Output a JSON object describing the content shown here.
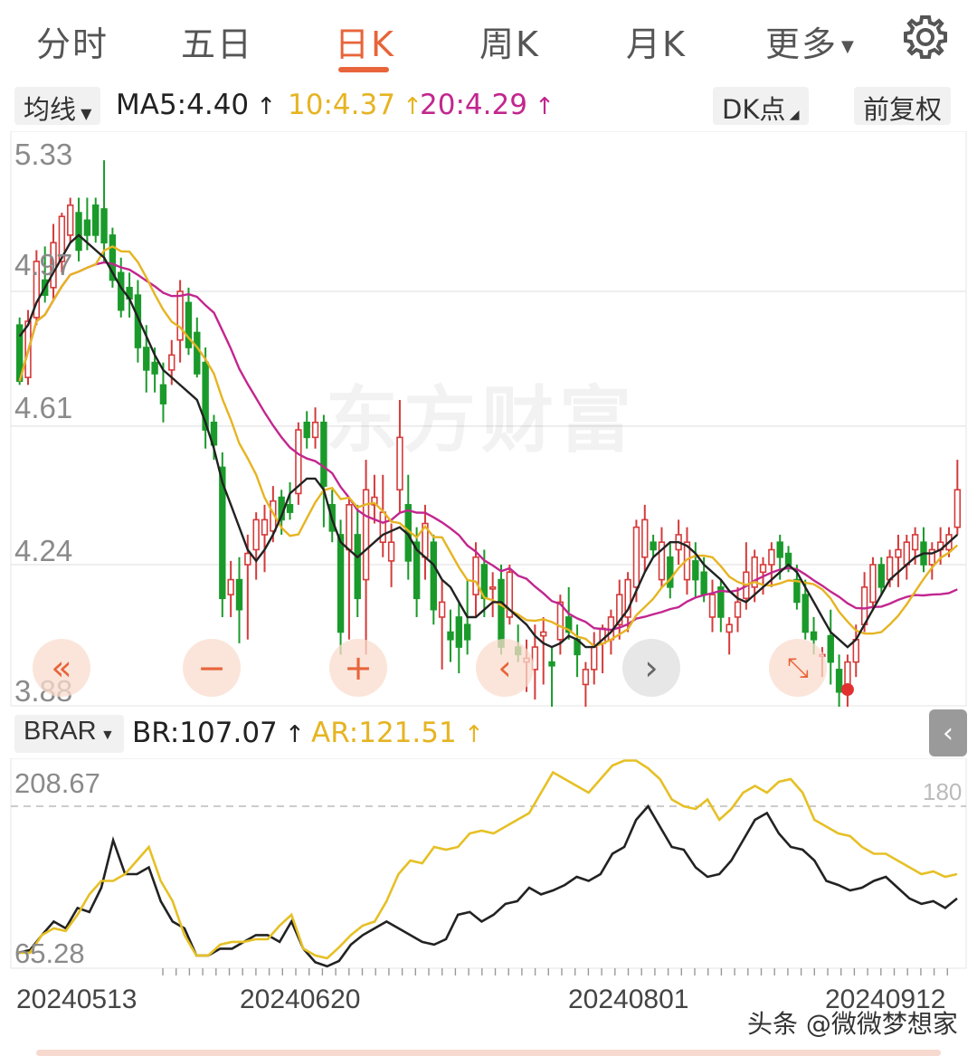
{
  "tabs": [
    {
      "label": "分时"
    },
    {
      "label": "五日"
    },
    {
      "label": "日K"
    },
    {
      "label": "周K"
    },
    {
      "label": "月K"
    },
    {
      "label": "更多"
    }
  ],
  "active_tab": "日K",
  "indicator_bar": {
    "ma_selector": "均线",
    "ma5": "MA5:4.40",
    "ma10": "10:4.37",
    "ma20": "20:4.29",
    "dk_button": "DK点",
    "adjust_button": "前复权"
  },
  "price_axis": {
    "labels": [
      "5.33",
      "4.97",
      "4.61",
      "4.24",
      "3.88"
    ]
  },
  "sub_indicator": {
    "selector": "BRAR",
    "br": "BR:107.07",
    "ar": "AR:121.51",
    "axis_top": "208.67",
    "axis_bottom": "65.28",
    "ref_line": "180"
  },
  "dates": [
    "20240513",
    "20240620",
    "20240801",
    "20240912"
  ],
  "watermark_text": "头条 @微微梦想家",
  "background_watermark": "东方财富",
  "colors": {
    "up": "#d53a3a",
    "down": "#1a9a2a",
    "ma5": "#222222",
    "ma10": "#e6b422",
    "ma20": "#c2268f",
    "accent": "#e8643a"
  },
  "chart_data": [
    {
      "type": "candlestick",
      "title": "",
      "ylim": [
        3.88,
        5.33
      ],
      "y_ticks": [
        5.33,
        4.97,
        4.61,
        4.24,
        3.88
      ],
      "x_ticks": [
        "20240513",
        "20240620",
        "20240801",
        "20240912"
      ],
      "ohlc": [
        [
          4.88,
          4.9,
          4.72,
          4.73
        ],
        [
          4.74,
          4.92,
          4.72,
          4.89
        ],
        [
          4.9,
          5.08,
          4.88,
          5.05
        ],
        [
          5.0,
          5.09,
          4.94,
          4.96
        ],
        [
          4.98,
          5.15,
          4.95,
          5.1
        ],
        [
          5.05,
          5.18,
          5.02,
          5.17
        ],
        [
          5.12,
          5.22,
          5.1,
          5.2
        ],
        [
          5.18,
          5.22,
          5.05,
          5.08
        ],
        [
          5.16,
          5.22,
          5.08,
          5.12
        ],
        [
          5.2,
          5.22,
          5.1,
          5.12
        ],
        [
          5.19,
          5.32,
          5.05,
          5.1
        ],
        [
          5.12,
          5.14,
          4.98,
          5.0
        ],
        [
          5.02,
          5.06,
          4.9,
          4.92
        ],
        [
          4.98,
          5.02,
          4.9,
          4.95
        ],
        [
          4.96,
          5.0,
          4.78,
          4.82
        ],
        [
          4.82,
          4.88,
          4.7,
          4.76
        ],
        [
          4.78,
          4.82,
          4.7,
          4.75
        ],
        [
          4.72,
          4.78,
          4.62,
          4.67
        ],
        [
          4.76,
          4.84,
          4.72,
          4.8
        ],
        [
          4.84,
          5.0,
          4.78,
          4.97
        ],
        [
          4.94,
          4.98,
          4.8,
          4.82
        ],
        [
          4.86,
          4.9,
          4.74,
          4.75
        ],
        [
          4.78,
          4.82,
          4.55,
          4.6
        ],
        [
          4.62,
          4.64,
          4.52,
          4.56
        ],
        [
          4.5,
          4.54,
          4.1,
          4.15
        ],
        [
          4.16,
          4.25,
          4.1,
          4.2
        ],
        [
          4.2,
          4.26,
          4.03,
          4.12
        ],
        [
          4.24,
          4.32,
          4.04,
          4.27
        ],
        [
          4.28,
          4.38,
          4.2,
          4.36
        ],
        [
          4.32,
          4.4,
          4.22,
          4.36
        ],
        [
          4.33,
          4.45,
          4.3,
          4.41
        ],
        [
          4.42,
          4.44,
          4.32,
          4.36
        ],
        [
          4.4,
          4.46,
          4.36,
          4.38
        ],
        [
          4.43,
          4.62,
          4.4,
          4.6
        ],
        [
          4.62,
          4.65,
          4.55,
          4.58
        ],
        [
          4.58,
          4.66,
          4.55,
          4.62
        ],
        [
          4.62,
          4.64,
          4.34,
          4.45
        ],
        [
          4.4,
          4.44,
          4.3,
          4.33
        ],
        [
          4.32,
          4.36,
          4.0,
          4.06
        ],
        [
          4.28,
          4.42,
          4.04,
          4.4
        ],
        [
          4.32,
          4.4,
          4.1,
          4.15
        ],
        [
          4.2,
          4.52,
          4.0,
          4.44
        ],
        [
          4.4,
          4.48,
          4.35,
          4.42
        ],
        [
          4.3,
          4.48,
          4.26,
          4.38
        ],
        [
          4.25,
          4.35,
          4.18,
          4.3
        ],
        [
          4.44,
          4.68,
          4.38,
          4.58
        ],
        [
          4.4,
          4.48,
          4.2,
          4.25
        ],
        [
          4.3,
          4.34,
          4.1,
          4.15
        ],
        [
          4.26,
          4.4,
          4.2,
          4.35
        ],
        [
          4.3,
          4.32,
          4.08,
          4.12
        ],
        [
          4.1,
          4.2,
          3.96,
          4.14
        ],
        [
          4.06,
          4.12,
          3.98,
          4.04
        ],
        [
          4.1,
          4.14,
          3.95,
          4.02
        ],
        [
          4.08,
          4.2,
          4.0,
          4.04
        ],
        [
          4.16,
          4.3,
          4.1,
          4.26
        ],
        [
          4.24,
          4.28,
          4.1,
          4.15
        ],
        [
          4.18,
          4.22,
          4.1,
          4.18
        ],
        [
          4.2,
          4.24,
          4.0,
          4.02
        ],
        [
          4.1,
          4.24,
          4.08,
          4.22
        ],
        [
          4.02,
          4.08,
          3.98,
          4.0
        ],
        [
          3.98,
          4.04,
          3.9,
          3.99
        ],
        [
          3.96,
          4.08,
          3.88,
          4.02
        ],
        [
          4.05,
          4.1,
          3.92,
          4.06
        ],
        [
          3.98,
          4.02,
          3.85,
          3.97
        ],
        [
          4.04,
          4.16,
          4.0,
          4.14
        ],
        [
          4.1,
          4.18,
          4.04,
          4.06
        ],
        [
          4.04,
          4.08,
          3.94,
          4.0
        ],
        [
          3.92,
          3.98,
          3.85,
          3.96
        ],
        [
          3.96,
          4.06,
          3.92,
          4.02
        ],
        [
          4.03,
          4.08,
          3.95,
          4.07
        ],
        [
          4.04,
          4.12,
          4.0,
          4.1
        ],
        [
          4.08,
          4.2,
          4.04,
          4.16
        ],
        [
          4.1,
          4.22,
          4.06,
          4.2
        ],
        [
          4.18,
          4.36,
          4.14,
          4.34
        ],
        [
          4.26,
          4.4,
          4.22,
          4.36
        ],
        [
          4.3,
          4.32,
          4.26,
          4.28
        ],
        [
          4.2,
          4.34,
          4.18,
          4.3
        ],
        [
          4.26,
          4.3,
          4.15,
          4.18
        ],
        [
          4.28,
          4.36,
          4.24,
          4.32
        ],
        [
          4.2,
          4.34,
          4.16,
          4.3
        ],
        [
          4.25,
          4.3,
          4.15,
          4.2
        ],
        [
          4.22,
          4.26,
          4.14,
          4.16
        ],
        [
          4.1,
          4.2,
          4.06,
          4.16
        ],
        [
          4.18,
          4.2,
          4.06,
          4.1
        ],
        [
          4.06,
          4.1,
          4.0,
          4.08
        ],
        [
          4.1,
          4.18,
          4.06,
          4.14
        ],
        [
          4.15,
          4.3,
          4.12,
          4.22
        ],
        [
          4.18,
          4.28,
          4.14,
          4.26
        ],
        [
          4.22,
          4.26,
          4.16,
          4.24
        ],
        [
          4.24,
          4.3,
          4.18,
          4.28
        ],
        [
          4.3,
          4.32,
          4.2,
          4.26
        ],
        [
          4.27,
          4.29,
          4.22,
          4.24
        ],
        [
          4.2,
          4.24,
          4.12,
          4.14
        ],
        [
          4.16,
          4.2,
          4.04,
          4.06
        ],
        [
          4.06,
          4.1,
          4.0,
          4.04
        ],
        [
          4.0,
          4.02,
          3.94,
          4.0
        ],
        [
          4.05,
          4.12,
          3.92,
          3.98
        ],
        [
          3.96,
          4.0,
          3.86,
          3.9
        ],
        [
          3.92,
          4.0,
          3.84,
          3.98
        ],
        [
          3.98,
          4.08,
          3.94,
          4.04
        ],
        [
          4.08,
          4.22,
          4.06,
          4.18
        ],
        [
          4.14,
          4.26,
          4.12,
          4.24
        ],
        [
          4.24,
          4.26,
          4.16,
          4.18
        ],
        [
          4.2,
          4.28,
          4.18,
          4.26
        ],
        [
          4.26,
          4.32,
          4.18,
          4.28
        ],
        [
          4.24,
          4.32,
          4.2,
          4.3
        ],
        [
          4.28,
          4.34,
          4.24,
          4.32
        ],
        [
          4.3,
          4.34,
          4.22,
          4.24
        ],
        [
          4.24,
          4.3,
          4.2,
          4.28
        ],
        [
          4.28,
          4.34,
          4.24,
          4.3
        ],
        [
          4.28,
          4.34,
          4.26,
          4.32
        ],
        [
          4.34,
          4.52,
          4.32,
          4.44
        ]
      ],
      "ma5": [
        4.85,
        4.88,
        4.94,
        4.98,
        5.02,
        5.06,
        5.1,
        5.12,
        5.1,
        5.08,
        5.06,
        5.02,
        4.98,
        4.95,
        4.9,
        4.85,
        4.8,
        4.76,
        4.74,
        4.72,
        4.7,
        4.68,
        4.62,
        4.55,
        4.46,
        4.4,
        4.34,
        4.28,
        4.25,
        4.28,
        4.32,
        4.37,
        4.43,
        4.45,
        4.47,
        4.47,
        4.44,
        4.36,
        4.3,
        4.28,
        4.26,
        4.28,
        4.3,
        4.32,
        4.33,
        4.34,
        4.32,
        4.28,
        4.26,
        4.24,
        4.2,
        4.18,
        4.14,
        4.1,
        4.1,
        4.12,
        4.14,
        4.14,
        4.12,
        4.1,
        4.08,
        4.05,
        4.03,
        4.02,
        4.03,
        4.05,
        4.04,
        4.02,
        4.02,
        4.04,
        4.06,
        4.09,
        4.12,
        4.17,
        4.22,
        4.26,
        4.28,
        4.3,
        4.3,
        4.29,
        4.27,
        4.24,
        4.22,
        4.2,
        4.17,
        4.15,
        4.14,
        4.16,
        4.18,
        4.2,
        4.22,
        4.24,
        4.22,
        4.18,
        4.14,
        4.1,
        4.06,
        4.04,
        4.02,
        4.04,
        4.08,
        4.12,
        4.16,
        4.2,
        4.22,
        4.24,
        4.26,
        4.27,
        4.27,
        4.28,
        4.3,
        4.32
      ]
    },
    {
      "type": "line",
      "title": "BRAR",
      "ylim": [
        65.28,
        208.67
      ],
      "reference_line": 180,
      "series": [
        {
          "name": "BR",
          "values": [
            72,
            74,
            85,
            95,
            90,
            105,
            102,
            120,
            155,
            130,
            130,
            135,
            110,
            95,
            90,
            70,
            70,
            75,
            75,
            80,
            85,
            85,
            80,
            95,
            75,
            65,
            62,
            66,
            78,
            85,
            90,
            95,
            90,
            85,
            80,
            78,
            82,
            100,
            102,
            95,
            100,
            108,
            110,
            120,
            115,
            118,
            122,
            128,
            125,
            130,
            145,
            150,
            170,
            180,
            165,
            150,
            148,
            135,
            128,
            130,
            140,
            155,
            170,
            175,
            160,
            150,
            148,
            140,
            125,
            122,
            118,
            120,
            125,
            128,
            120,
            112,
            108,
            110,
            105,
            112
          ]
        },
        {
          "name": "AR",
          "values": [
            72,
            72,
            85,
            90,
            88,
            100,
            115,
            125,
            125,
            130,
            140,
            150,
            125,
            110,
            85,
            70,
            70,
            78,
            80,
            80,
            82,
            82,
            92,
            100,
            75,
            70,
            68,
            76,
            85,
            92,
            95,
            110,
            130,
            140,
            138,
            150,
            148,
            150,
            160,
            162,
            160,
            165,
            170,
            175,
            190,
            205,
            200,
            195,
            190,
            200,
            210,
            220,
            230,
            208,
            200,
            185,
            180,
            178,
            185,
            170,
            178,
            190,
            195,
            190,
            198,
            200,
            190,
            170,
            165,
            160,
            158,
            150,
            145,
            145,
            140,
            135,
            130,
            132,
            128,
            130
          ]
        }
      ]
    }
  ]
}
